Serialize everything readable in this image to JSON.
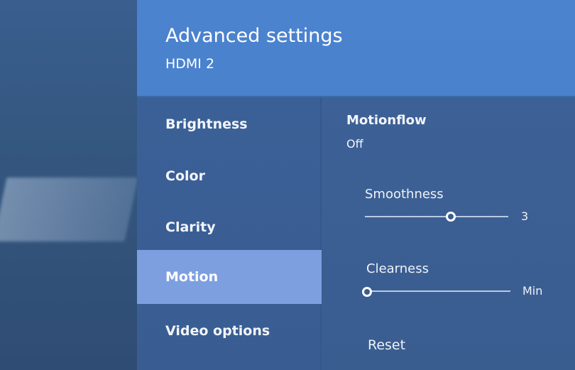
{
  "header": {
    "title": "Advanced settings",
    "subtitle": "HDMI 2"
  },
  "menu": {
    "items": [
      {
        "label": "Brightness"
      },
      {
        "label": "Color"
      },
      {
        "label": "Clarity"
      },
      {
        "label": "Motion",
        "selected": true
      },
      {
        "label": "Video options"
      }
    ]
  },
  "detail": {
    "motionflow": {
      "label": "Motionflow",
      "value": "Off"
    },
    "smoothness": {
      "label": "Smoothness",
      "value": "3"
    },
    "clearness": {
      "label": "Clearness",
      "value": "Min"
    },
    "reset_label": "Reset"
  },
  "colors": {
    "header_bg": "#4b83cf",
    "selected_item_bg": "#7d9fe0",
    "panel_bg": "#3b6097"
  }
}
